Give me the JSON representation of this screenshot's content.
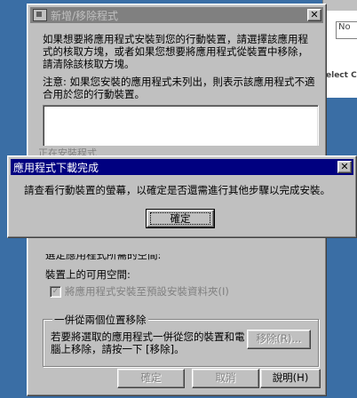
{
  "background_window": {
    "partial_field": "No",
    "partial_label": "elect C"
  },
  "main_window": {
    "title": "新增/移除程式",
    "intro_text": "如果想要將應用程式安裝到您的行動裝置，請選擇該應用程式的核取方塊，或者如果您想要將應用程式從裝置中移除，請清除該核取方塊。",
    "note_text": "注意: 如果您安裝的應用程式未列出，則表示該應用程式不適合用於您的行動裝置。",
    "hidden_row_text": "正在安裝程式",
    "space_needed_label": "選定應用程式所需的空間:",
    "space_available_label": "裝置上的可用空間:",
    "default_install_checkbox": "將應用程式安裝至預設安裝資料夾(I)",
    "remove_group": {
      "legend": "一併從兩個位置移除",
      "text": "若要將選取的應用程式一併從您的裝置和電腦上移除，請按一下 [移除]。",
      "remove_button": "移除(R)..."
    },
    "buttons": {
      "ok": "確定",
      "cancel": "取消",
      "help": "說明(H)"
    }
  },
  "dialog": {
    "title": "應用程式下載完成",
    "message": "請查看行動裝置的螢幕，以確定是否還需進行其他步驟以完成安裝。",
    "ok_button": "確定"
  },
  "colors": {
    "desktop": "#3a6ea5",
    "active_title": "#000080",
    "inactive_title": "#808080",
    "face": "#c0c0c0"
  }
}
